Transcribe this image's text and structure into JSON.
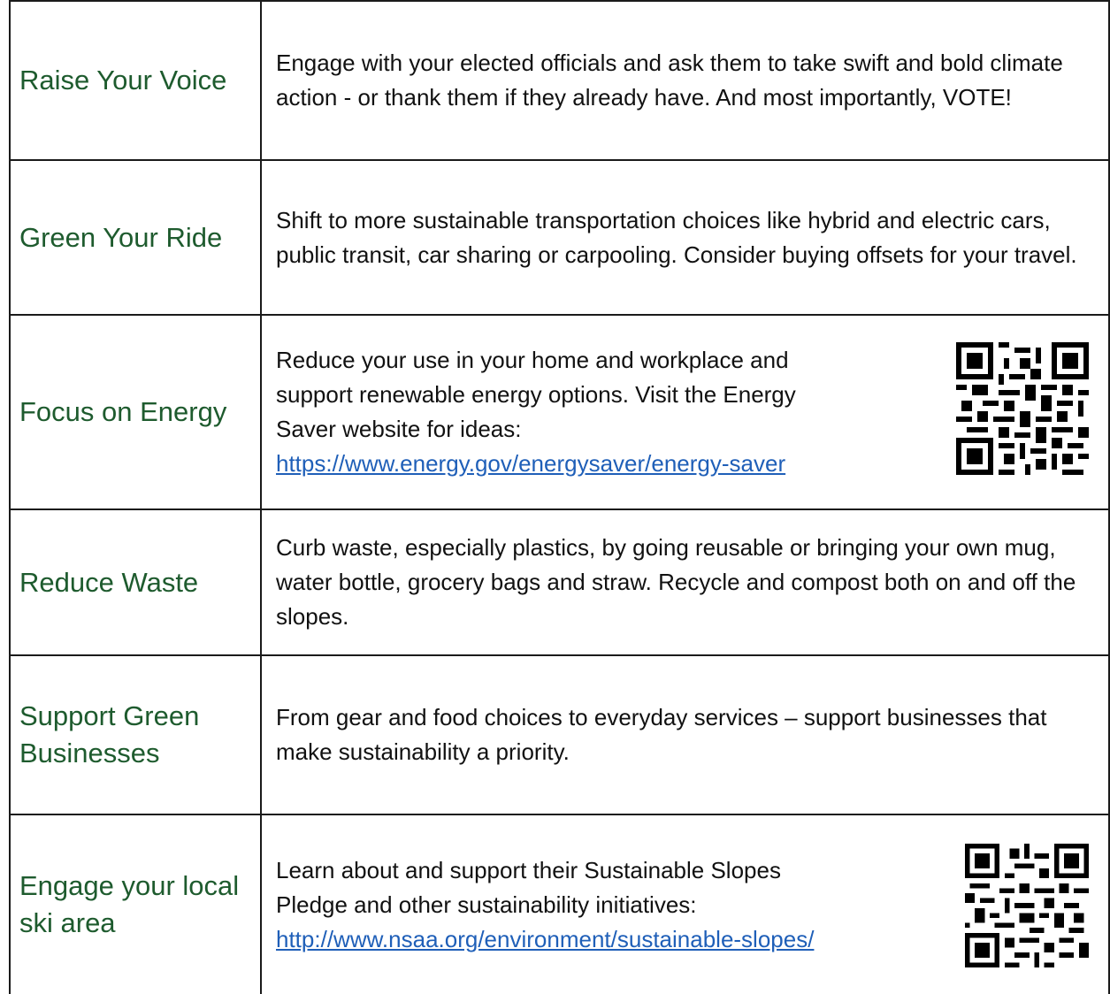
{
  "rows": [
    {
      "label": "Raise Your Voice",
      "text": "Engage with your elected officials and ask them to take swift and bold climate action - or thank them if they already have. And most importantly, VOTE!"
    },
    {
      "label": "Green Your Ride",
      "text": "Shift to more sustainable transportation choices like hybrid and electric cars, public transit, car sharing or carpooling. Consider buying offsets for your travel."
    },
    {
      "label": "Focus on Energy",
      "text": "Reduce your use in your home and workplace and support renewable energy options. Visit the Energy Saver website for ideas:",
      "link": "https://www.energy.gov/energysaver/energy-saver",
      "qr_icon": "qr-code-icon"
    },
    {
      "label": "Reduce Waste",
      "text": "Curb waste, especially plastics, by going reusable or bringing your own mug, water bottle, grocery bags and straw. Recycle and compost both on and off the slopes."
    },
    {
      "label": "Support Green Businesses",
      "text": "From gear and food choices to everyday services – support businesses that make sustainability a priority."
    },
    {
      "label": "Engage your local ski area",
      "text": "Learn about and support their Sustainable Slopes Pledge and other sustainability initiatives:",
      "link": "http://www.nsaa.org/environment/sustainable-slopes/",
      "qr_icon": "qr-code-icon"
    }
  ],
  "colors": {
    "label_green": "#1e5b2e",
    "link_blue": "#1f5fb8",
    "border": "#1a1a1a"
  }
}
